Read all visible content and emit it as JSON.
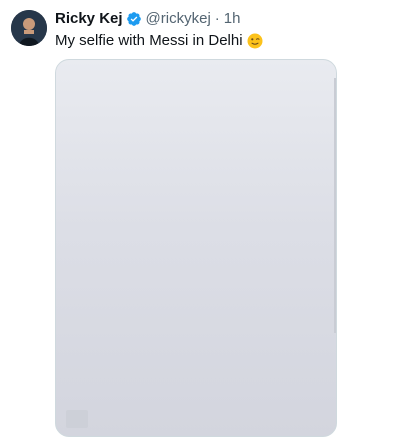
{
  "tweet": {
    "display_name": "Ricky Kej",
    "handle": "@rickykej",
    "separator": "·",
    "time": "1h",
    "text": "My selfie with Messi in Delhi",
    "emoji_icon": "winking-face-emoji",
    "verified_icon": "verified-badge-icon",
    "verified_color": "#1d9bf0",
    "avatar_icon": "profile-avatar",
    "media_icon": "tweet-photo"
  }
}
